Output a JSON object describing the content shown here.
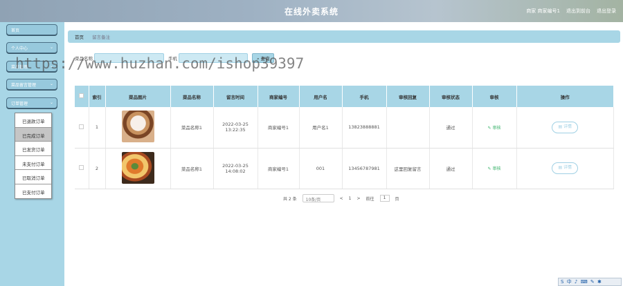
{
  "header": {
    "title": "在线外卖系统",
    "user": "商家 商家编号1",
    "back_front": "退出到前台",
    "logout": "退出登录"
  },
  "sidebar": {
    "items": [
      {
        "label": "首页"
      },
      {
        "label": "个人中心"
      },
      {
        "label": "菜品管理"
      },
      {
        "label": "菜品留言管理"
      },
      {
        "label": "订单管理"
      }
    ],
    "submenu": [
      "已退款订单",
      "已完成订单",
      "已发货订单",
      "未支付订单",
      "已取消订单",
      "已支付订单"
    ]
  },
  "breadcrumb": {
    "home": "首页",
    "current": "留言备注"
  },
  "search": {
    "label1": "菜品名称",
    "label2": "手机",
    "button": "查询"
  },
  "watermark": "https://www.huzhan.com/ishop39397",
  "table": {
    "headers": [
      "索引",
      "菜品图片",
      "菜品名称",
      "留言时间",
      "商家编号",
      "用户名",
      "手机",
      "审核回复",
      "审核状态",
      "审核",
      "操作"
    ],
    "rows": [
      {
        "index": "1",
        "name": "菜品名称1",
        "time": "2022-03-25 13:22:35",
        "merchant": "商家编号1",
        "user": "用户名1",
        "phone": "13823888881",
        "reply": "",
        "status": "通过",
        "approve": "审核",
        "action": "详情"
      },
      {
        "index": "2",
        "name": "菜品名称1",
        "time": "2022-03-25 14:08:02",
        "merchant": "商家编号1",
        "user": "001",
        "phone": "13456787981",
        "reply": "这里回复留言",
        "status": "通过",
        "approve": "审核",
        "action": "详情"
      }
    ]
  },
  "pager": {
    "total": "共 2 条",
    "page_size": "10条/页",
    "prev": "<",
    "page": "1",
    "next": ">",
    "goto_label": "前往",
    "goto_value": "1",
    "goto_unit": "页"
  },
  "tray": "中 ♪ ⌨ ✎ ✱"
}
